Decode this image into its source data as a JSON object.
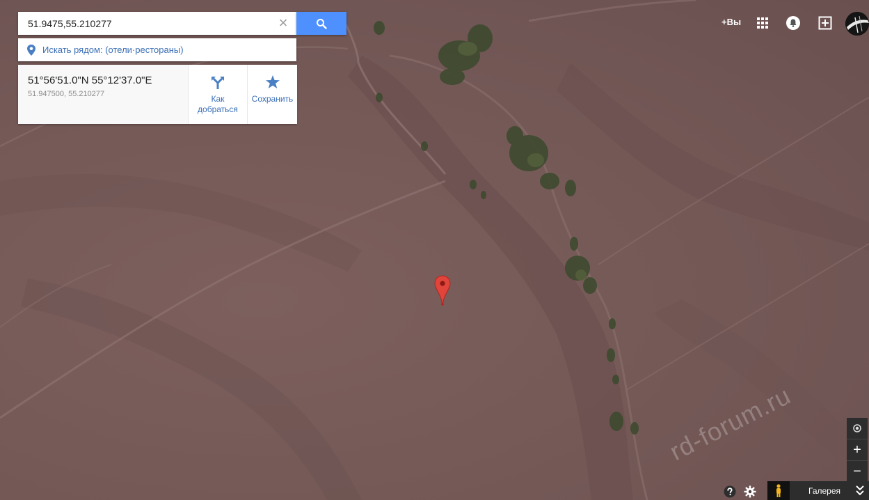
{
  "search": {
    "query": "51.9475,55.210277",
    "clear_glyph": "×"
  },
  "nearby": {
    "text": "Искать рядом: (отели·рестораны)"
  },
  "place": {
    "dms": "51°56'51.0\"N 55°12'37.0\"E",
    "decimal": "51.947500, 55.210277",
    "route_label_1": "Как",
    "route_label_2": "добраться",
    "save_label": "Сохранить"
  },
  "header": {
    "plus_you": "+Вы"
  },
  "controls": {
    "zoom_in": "+",
    "zoom_out": "−",
    "gallery": "Галерея"
  },
  "watermark": "rd-forum.ru",
  "colors": {
    "accent_blue": "#4d90fe",
    "link_blue": "#3b6fb6",
    "marker_red": "#e0443a",
    "terrain": "#735856"
  },
  "icons": [
    "search-icon",
    "close-icon",
    "location-pin-icon",
    "directions-icon",
    "star-icon",
    "apps-grid-icon",
    "notifications-icon",
    "share-plus-icon",
    "my-location-icon",
    "help-icon",
    "settings-icon",
    "pegman-icon",
    "chevron-down-icon",
    "map-marker-icon"
  ]
}
